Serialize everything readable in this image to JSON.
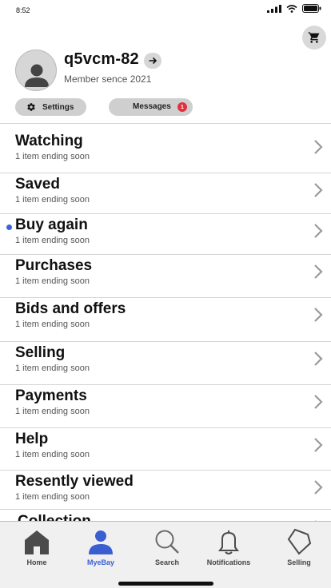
{
  "status": {
    "time": "8:52"
  },
  "profile": {
    "username": "q5vcm-82",
    "member_since": "Member sence 2021",
    "settings_label": "Settings",
    "messages_label": "Messages",
    "messages_count": "1"
  },
  "menu": [
    {
      "title": "Watching",
      "subtitle": "1 item ending soon",
      "unread": false
    },
    {
      "title": "Saved",
      "subtitle": "1 item ending soon",
      "unread": false
    },
    {
      "title": "Buy again",
      "subtitle": "1 item ending soon",
      "unread": true
    },
    {
      "title": "Purchases",
      "subtitle": "1 item ending soon",
      "unread": false
    },
    {
      "title": "Bids and offers",
      "subtitle": "1 item ending soon",
      "unread": false
    },
    {
      "title": "Selling",
      "subtitle": "1 item ending soon",
      "unread": false
    },
    {
      "title": "Payments",
      "subtitle": "1 item ending soon",
      "unread": false
    },
    {
      "title": "Help",
      "subtitle": "1 item ending soon",
      "unread": false
    },
    {
      "title": "Resently viewed",
      "subtitle": "1 item ending soon",
      "unread": false
    },
    {
      "title": "Collection",
      "subtitle": "",
      "unread": false
    }
  ],
  "tabs": [
    {
      "label": "Home",
      "icon": "home-icon",
      "active": false
    },
    {
      "label": "MyeBay",
      "icon": "person-icon",
      "active": true
    },
    {
      "label": "Search",
      "icon": "search-icon",
      "active": false
    },
    {
      "label": "Notifications",
      "icon": "bell-icon",
      "active": false
    },
    {
      "label": "Selling",
      "icon": "tag-icon",
      "active": false
    }
  ],
  "colors": {
    "accent": "#3a5fd0",
    "badge": "#e0323e",
    "unread_dot": "#3a64d8",
    "pill": "#cfcfcf"
  }
}
